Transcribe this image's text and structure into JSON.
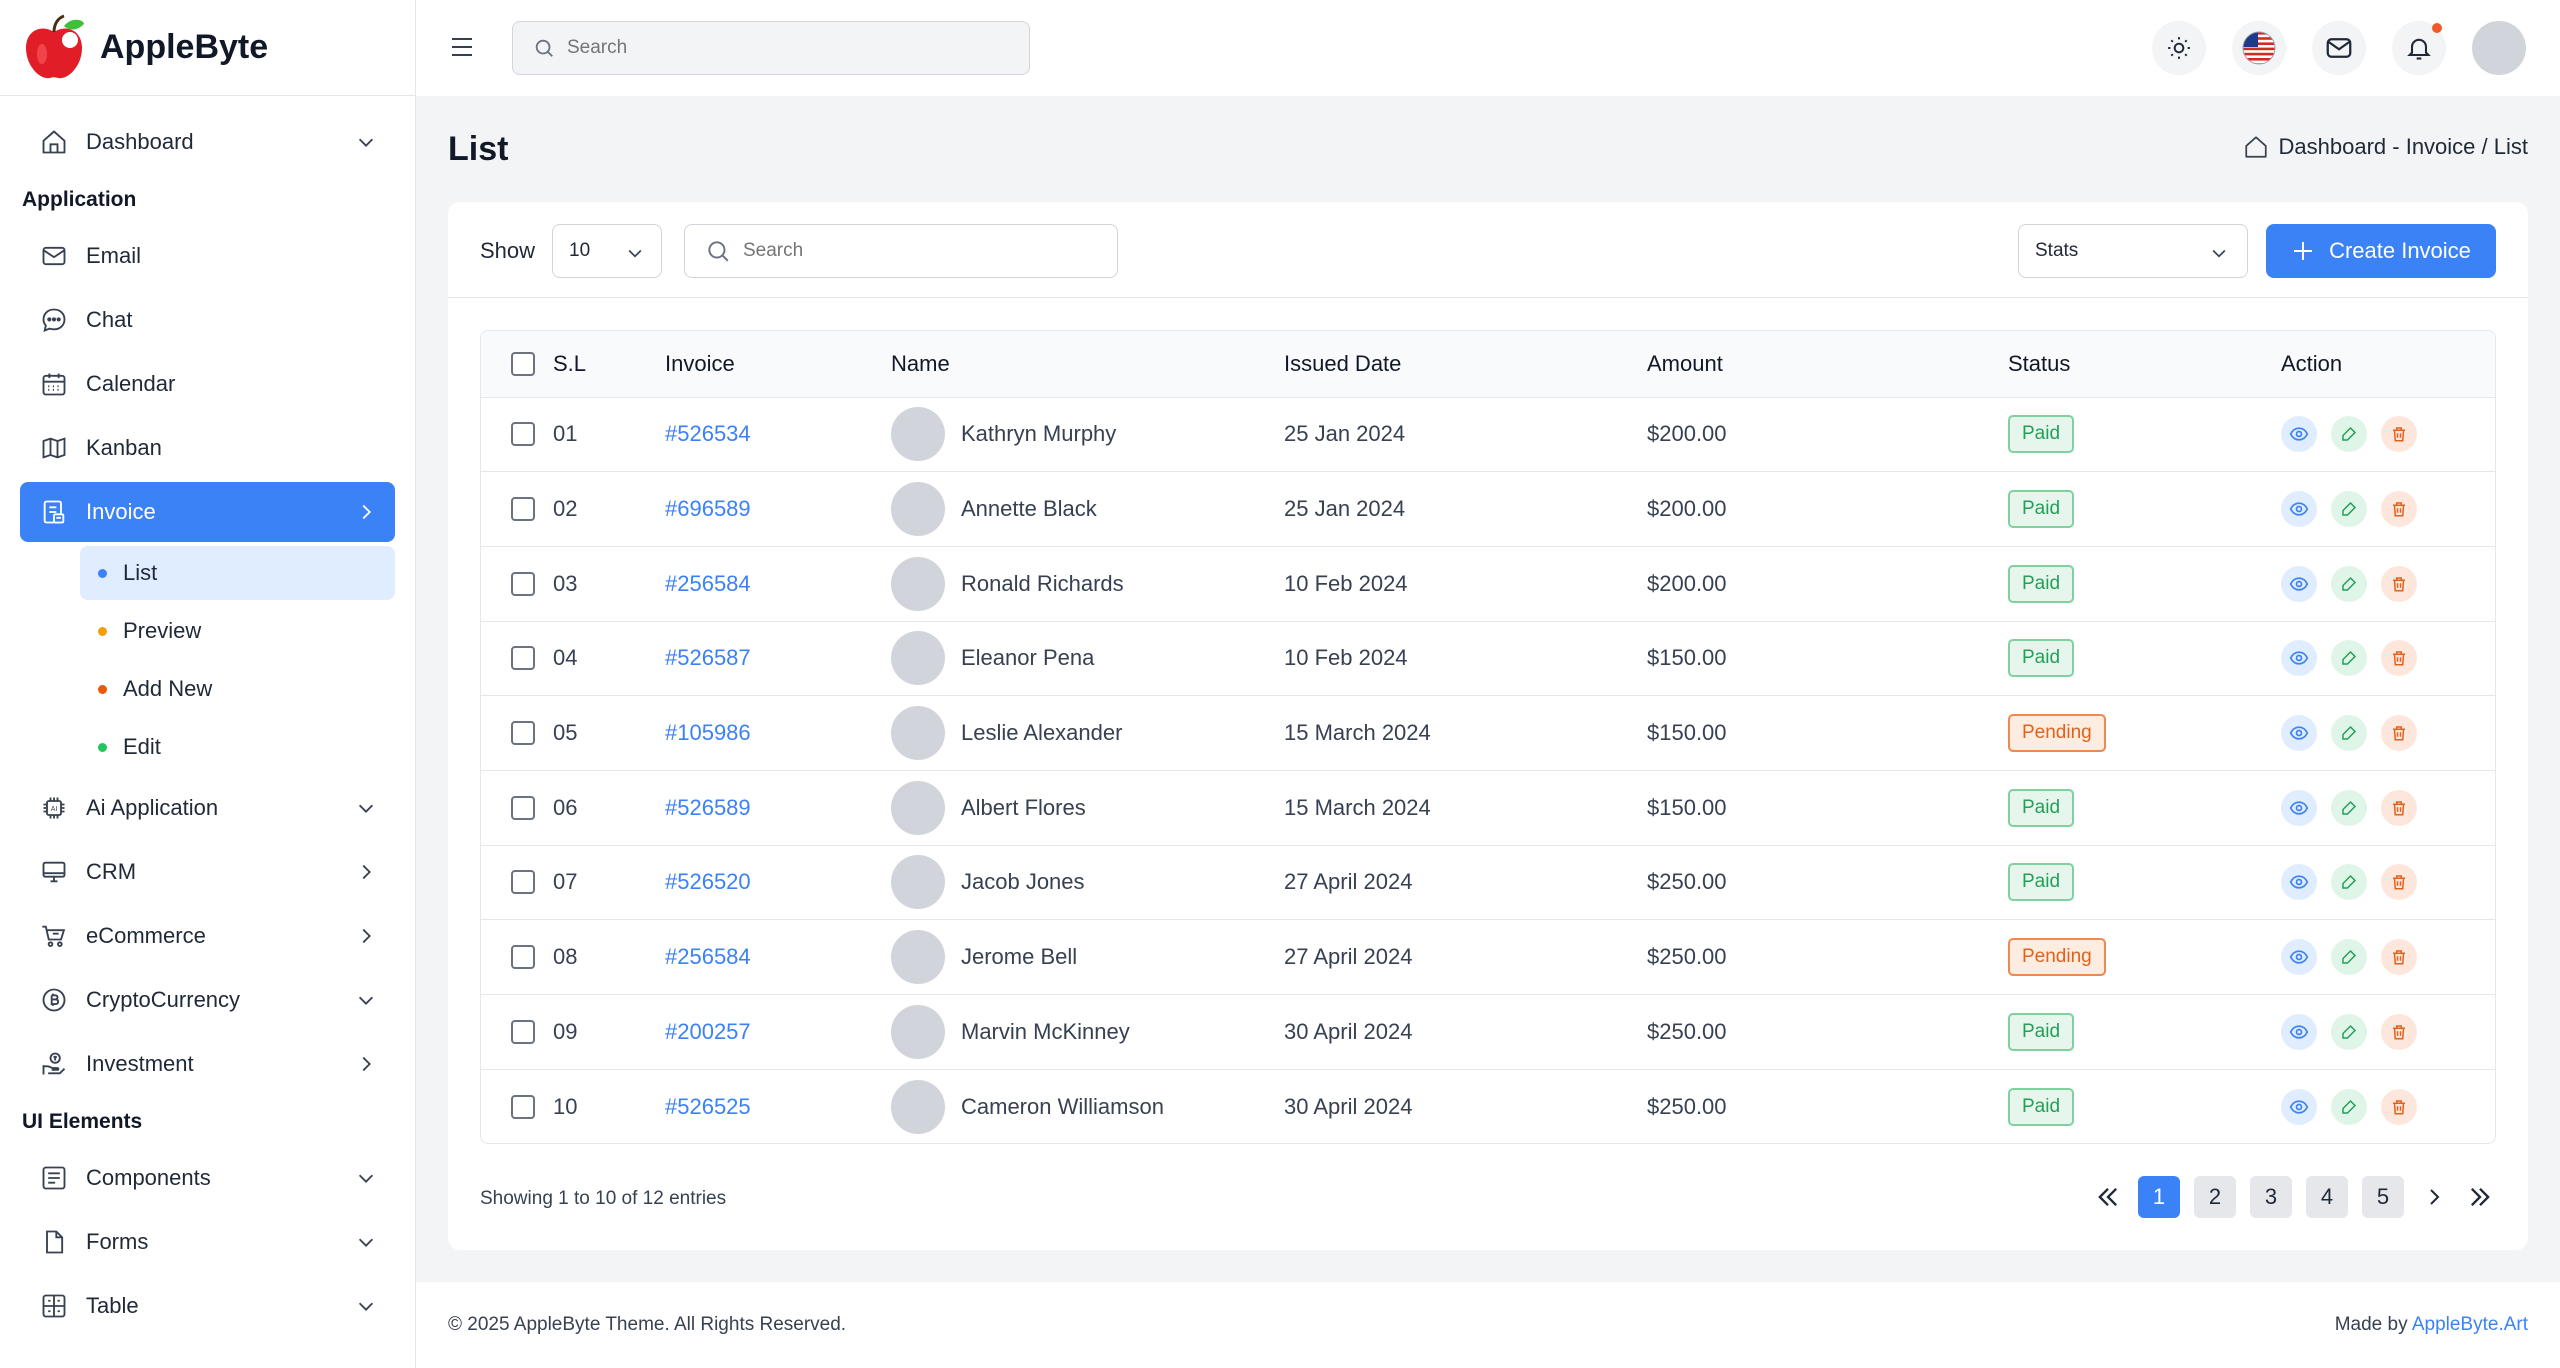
{
  "brand": {
    "name": "AppleByte"
  },
  "sidebar": {
    "items_top": [
      {
        "label": "Dashboard",
        "icon": "home-icon",
        "arrow": "down"
      }
    ],
    "heading_application": "Application",
    "app_items": [
      {
        "label": "Email",
        "icon": "mail-icon"
      },
      {
        "label": "Chat",
        "icon": "chat-icon"
      },
      {
        "label": "Calendar",
        "icon": "calendar-icon"
      },
      {
        "label": "Kanban",
        "icon": "map-icon"
      },
      {
        "label": "Invoice",
        "icon": "invoice-icon",
        "arrow": "right",
        "active": true
      }
    ],
    "invoice_sub": [
      {
        "label": "List",
        "dot": "#3b82f6",
        "active": true
      },
      {
        "label": "Preview",
        "dot": "#f59e0b"
      },
      {
        "label": "Add New",
        "dot": "#ea580c"
      },
      {
        "label": "Edit",
        "dot": "#22c55e"
      }
    ],
    "more_items": [
      {
        "label": "Ai Application",
        "icon": "ai-chip-icon",
        "arrow": "down"
      },
      {
        "label": "CRM",
        "icon": "monitor-icon",
        "arrow": "right"
      },
      {
        "label": "eCommerce",
        "icon": "cart-icon",
        "arrow": "right"
      },
      {
        "label": "CryptoCurrency",
        "icon": "bitcoin-icon",
        "arrow": "down"
      },
      {
        "label": "Investment",
        "icon": "investment-icon",
        "arrow": "right"
      }
    ],
    "heading_ui": "UI Elements",
    "ui_items": [
      {
        "label": "Components",
        "icon": "components-icon",
        "arrow": "down"
      },
      {
        "label": "Forms",
        "icon": "file-icon",
        "arrow": "down"
      },
      {
        "label": "Table",
        "icon": "table-icon",
        "arrow": "down"
      }
    ]
  },
  "topbar": {
    "search_placeholder": "Search"
  },
  "page": {
    "title": "List",
    "breadcrumb": "Dashboard - Invoice / List"
  },
  "toolbar": {
    "show_label": "Show",
    "show_value": "10",
    "search_placeholder": "Search",
    "stats_label": "Stats",
    "create_label": "Create Invoice"
  },
  "table": {
    "headers": [
      "S.L",
      "Invoice",
      "Name",
      "Issued Date",
      "Amount",
      "Status",
      "Action"
    ],
    "rows": [
      {
        "sl": "01",
        "invoice": "#526534",
        "name": "Kathryn Murphy",
        "date": "25 Jan 2024",
        "amount": "$200.00",
        "status": "Paid"
      },
      {
        "sl": "02",
        "invoice": "#696589",
        "name": "Annette Black",
        "date": "25 Jan 2024",
        "amount": "$200.00",
        "status": "Paid"
      },
      {
        "sl": "03",
        "invoice": "#256584",
        "name": "Ronald Richards",
        "date": "10 Feb 2024",
        "amount": "$200.00",
        "status": "Paid"
      },
      {
        "sl": "04",
        "invoice": "#526587",
        "name": "Eleanor Pena",
        "date": "10 Feb 2024",
        "amount": "$150.00",
        "status": "Paid"
      },
      {
        "sl": "05",
        "invoice": "#105986",
        "name": "Leslie Alexander",
        "date": "15 March 2024",
        "amount": "$150.00",
        "status": "Pending"
      },
      {
        "sl": "06",
        "invoice": "#526589",
        "name": "Albert Flores",
        "date": "15 March 2024",
        "amount": "$150.00",
        "status": "Paid"
      },
      {
        "sl": "07",
        "invoice": "#526520",
        "name": "Jacob Jones",
        "date": "27 April 2024",
        "amount": "$250.00",
        "status": "Paid"
      },
      {
        "sl": "08",
        "invoice": "#256584",
        "name": "Jerome Bell",
        "date": "27 April 2024",
        "amount": "$250.00",
        "status": "Pending"
      },
      {
        "sl": "09",
        "invoice": "#200257",
        "name": "Marvin McKinney",
        "date": "30 April 2024",
        "amount": "$250.00",
        "status": "Paid"
      },
      {
        "sl": "10",
        "invoice": "#526525",
        "name": "Cameron Williamson",
        "date": "30 April 2024",
        "amount": "$250.00",
        "status": "Paid"
      }
    ]
  },
  "pagination": {
    "showing": "Showing 1 to 10 of 12 entries",
    "pages": [
      "1",
      "2",
      "3",
      "4",
      "5"
    ],
    "active": "1"
  },
  "footer": {
    "copyright": "© 2025 AppleByte Theme. All Rights Reserved.",
    "made_by": "Made by",
    "made_by_link": "AppleByte.Art"
  },
  "colors": {
    "accent": "#3b82f6",
    "paid": "#22a05a",
    "pending": "#e0621d",
    "notif": "#f05a28"
  }
}
